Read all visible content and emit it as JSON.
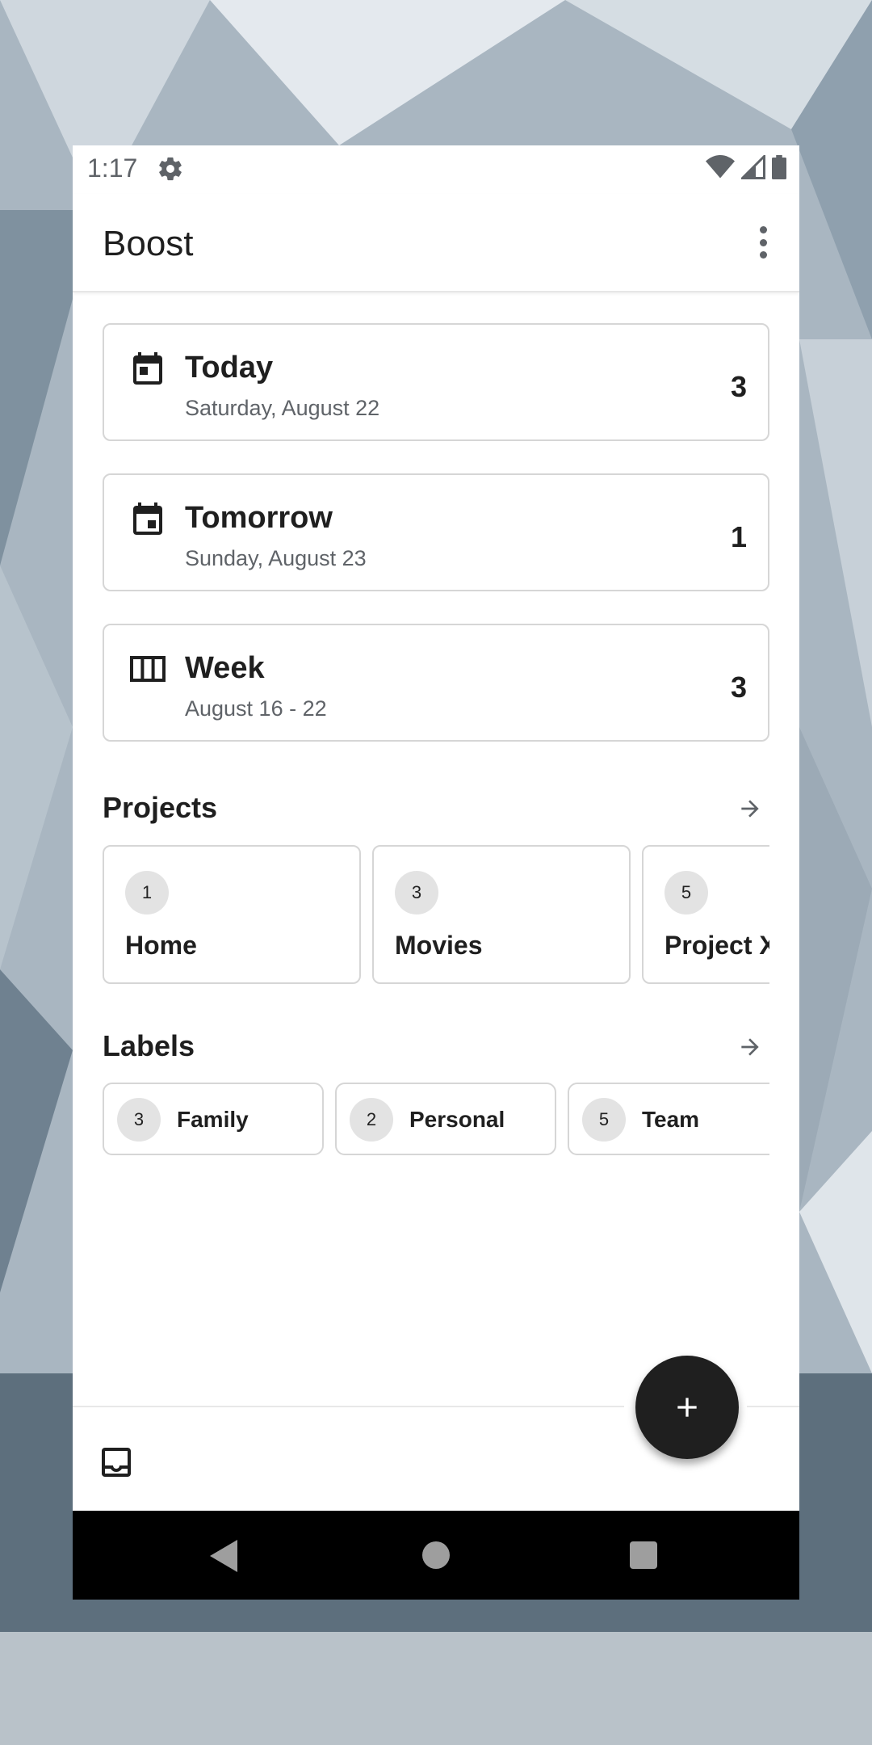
{
  "status_bar": {
    "time": "1:17",
    "icons": [
      "gear-icon",
      "wifi-icon",
      "cell-signal-icon",
      "battery-icon"
    ]
  },
  "app_bar": {
    "title": "Boost",
    "menu_icon": "more-vert-icon"
  },
  "summary": [
    {
      "icon": "calendar-today-icon",
      "title": "Today",
      "subtitle": "Saturday, August 22",
      "count": "3"
    },
    {
      "icon": "calendar-event-icon",
      "title": "Tomorrow",
      "subtitle": "Sunday, August 23",
      "count": "1"
    },
    {
      "icon": "view-week-icon",
      "title": "Week",
      "subtitle": "August 16 - 22",
      "count": "3"
    }
  ],
  "projects": {
    "heading": "Projects",
    "items": [
      {
        "count": "1",
        "name": "Home"
      },
      {
        "count": "3",
        "name": "Movies"
      },
      {
        "count": "5",
        "name": "Project X"
      }
    ]
  },
  "labels": {
    "heading": "Labels",
    "items": [
      {
        "count": "3",
        "name": "Family"
      },
      {
        "count": "2",
        "name": "Personal"
      },
      {
        "count": "5",
        "name": "Team"
      }
    ]
  },
  "bottom_bar": {
    "left_icon": "inbox-icon",
    "fab_icon": "plus-icon"
  },
  "colors": {
    "surface": "#ffffff",
    "text": "#1f1f1f",
    "secondary_text": "#5f6368",
    "border": "#d6d6d6",
    "fab": "#1f1f1f",
    "badge": "#e3e3e3"
  }
}
